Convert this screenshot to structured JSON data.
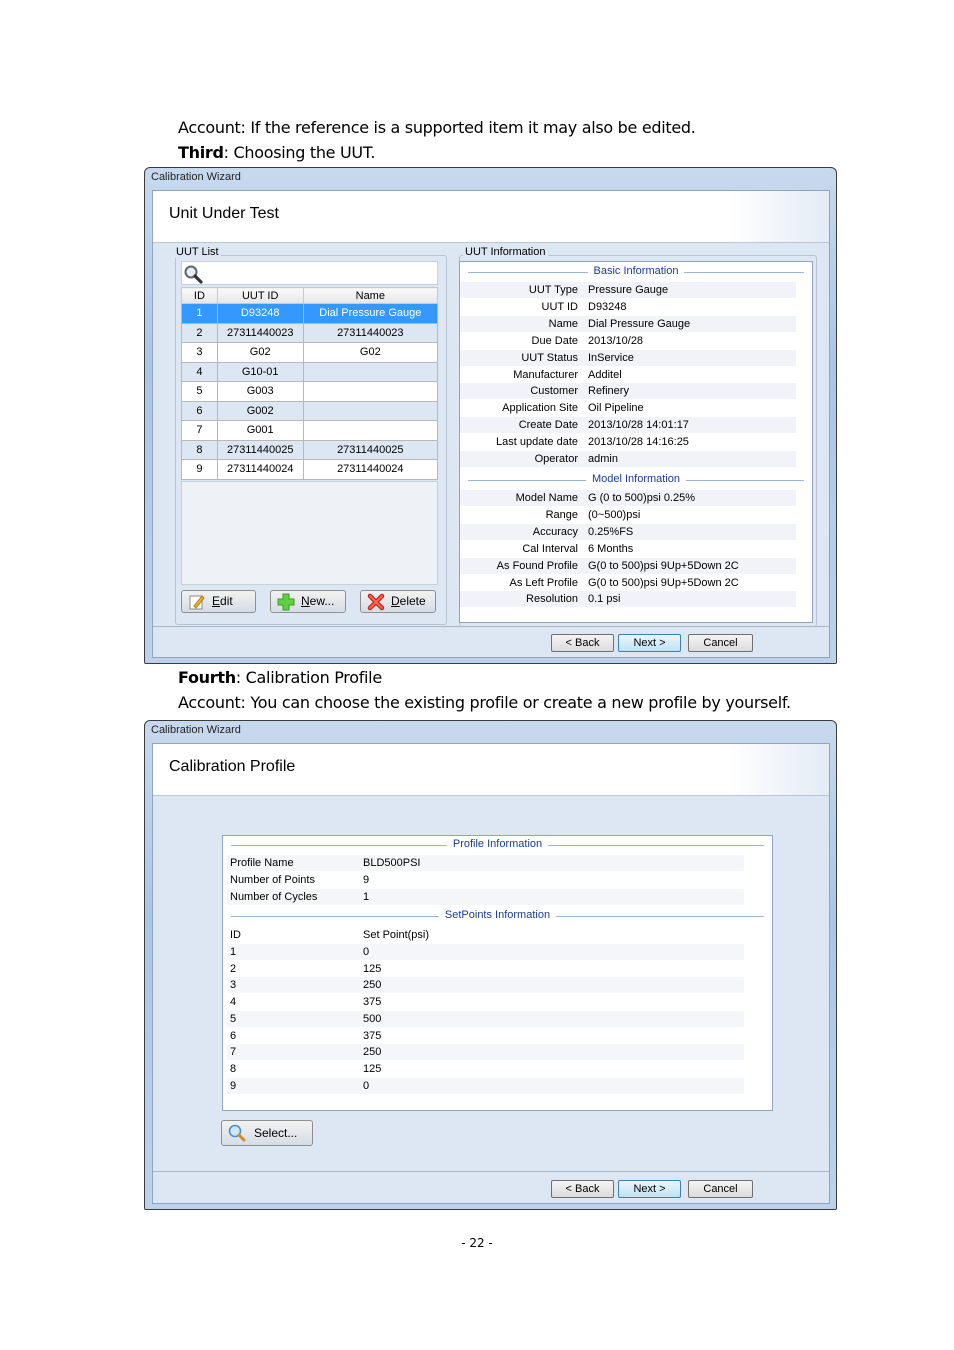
{
  "doc": {
    "para1": "Account: If the reference is a supported item it may also be edited.",
    "para2_bold": "Third",
    "para2_rest": ": Choosing the UUT.",
    "para3_bold": "Fourth",
    "para3_rest": ": Calibration Profile",
    "para4": "Account: You can choose the existing profile or create a new profile by yourself.",
    "page_number": "- 22 -"
  },
  "wizard1": {
    "title": "Calibration Wizard",
    "heading": "Unit Under Test",
    "uut_list_label": "UUT List",
    "uut_info_label": "UUT Information",
    "table": {
      "columns": [
        "ID",
        "UUT ID",
        "Name"
      ],
      "rows": [
        {
          "id": "1",
          "uut_id": "D93248",
          "name": "Dial Pressure Gauge",
          "selected": true
        },
        {
          "id": "2",
          "uut_id": "27311440023",
          "name": "27311440023"
        },
        {
          "id": "3",
          "uut_id": "G02",
          "name": "G02"
        },
        {
          "id": "4",
          "uut_id": "G10-01",
          "name": ""
        },
        {
          "id": "5",
          "uut_id": "G003",
          "name": ""
        },
        {
          "id": "6",
          "uut_id": "G002",
          "name": ""
        },
        {
          "id": "7",
          "uut_id": "G001",
          "name": ""
        },
        {
          "id": "8",
          "uut_id": "27311440025",
          "name": "27311440025"
        },
        {
          "id": "9",
          "uut_id": "27311440024",
          "name": "27311440024"
        }
      ]
    },
    "buttons": {
      "edit_u": "E",
      "edit_rest": "dit",
      "new_u": "N",
      "new_rest": "ew...",
      "delete_u": "D",
      "delete_rest": "elete"
    },
    "basic_title": "Basic Information",
    "basic": [
      {
        "k": "UUT Type",
        "v": "Pressure Gauge"
      },
      {
        "k": "UUT ID",
        "v": "D93248"
      },
      {
        "k": "Name",
        "v": "Dial Pressure Gauge"
      },
      {
        "k": "Due Date",
        "v": "2013/10/28"
      },
      {
        "k": "UUT Status",
        "v": "InService"
      },
      {
        "k": "Manufacturer",
        "v": "Additel"
      },
      {
        "k": "Customer",
        "v": "Refinery"
      },
      {
        "k": "Application Site",
        "v": "Oil Pipeline"
      },
      {
        "k": "Create Date",
        "v": "2013/10/28 14:01:17"
      },
      {
        "k": "Last update date",
        "v": "2013/10/28 14:16:25"
      },
      {
        "k": "Operator",
        "v": "admin"
      }
    ],
    "model_title": "Model Information",
    "model": [
      {
        "k": "Model Name",
        "v": "G (0 to 500)psi 0.25%"
      },
      {
        "k": "Range",
        "v": "(0~500)psi"
      },
      {
        "k": "Accuracy",
        "v": "0.25%FS"
      },
      {
        "k": "Cal Interval",
        "v": "6 Months"
      },
      {
        "k": "As Found Profile",
        "v": "G(0 to 500)psi 9Up+5Down 2C"
      },
      {
        "k": "As Left Profile",
        "v": "G(0 to 500)psi 9Up+5Down 2C"
      },
      {
        "k": "Resolution",
        "v": "0.1 psi"
      }
    ],
    "nav": {
      "back": "< Back",
      "next": "Next >",
      "cancel": "Cancel"
    }
  },
  "wizard2": {
    "title": "Calibration Wizard",
    "heading": "Calibration Profile",
    "profile_title": "Profile Information",
    "profile": [
      {
        "k": "Profile Name",
        "v": "BLD500PSI"
      },
      {
        "k": "Number of Points",
        "v": "9"
      },
      {
        "k": "Number of Cycles",
        "v": "1"
      }
    ],
    "setpoints_title": "SetPoints Information",
    "setpoints_header": {
      "id": "ID",
      "value": "Set Point(psi)"
    },
    "setpoints": [
      {
        "id": "1",
        "value": "0"
      },
      {
        "id": "2",
        "value": "125"
      },
      {
        "id": "3",
        "value": "250"
      },
      {
        "id": "4",
        "value": "375"
      },
      {
        "id": "5",
        "value": "500"
      },
      {
        "id": "6",
        "value": "375"
      },
      {
        "id": "7",
        "value": "250"
      },
      {
        "id": "8",
        "value": "125"
      },
      {
        "id": "9",
        "value": "0"
      }
    ],
    "select_label": "Select...",
    "nav": {
      "back": "< Back",
      "next": "Next >",
      "cancel": "Cancel"
    }
  }
}
